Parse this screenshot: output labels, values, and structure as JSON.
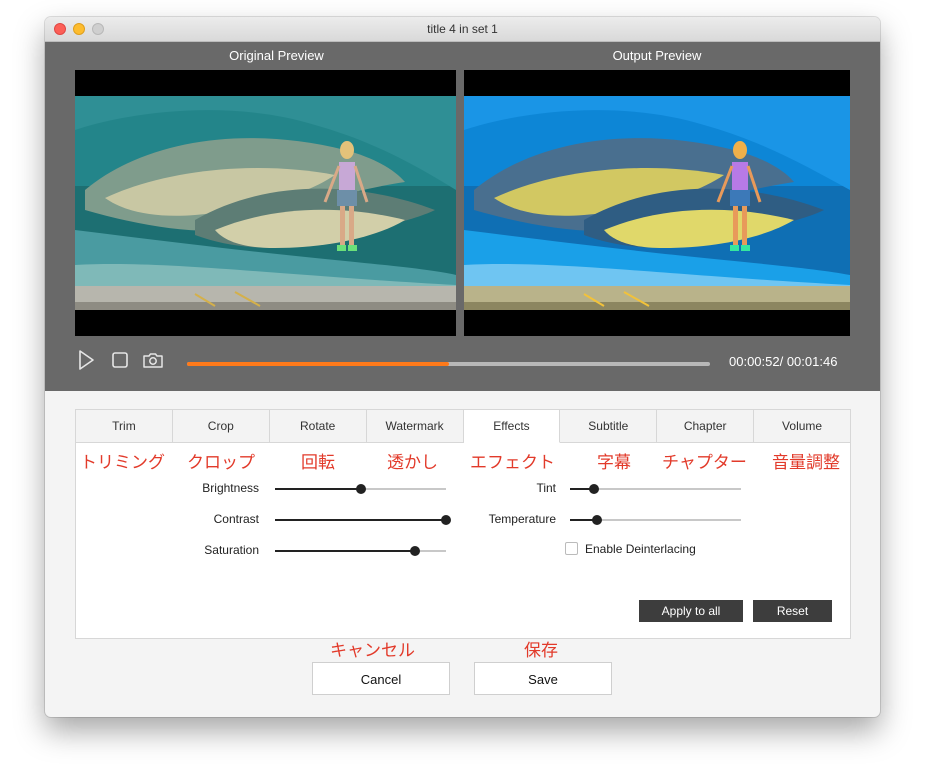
{
  "window": {
    "title": "title 4 in set 1"
  },
  "preview": {
    "original_label": "Original Preview",
    "output_label": "Output  Preview",
    "time": "00:00:52/ 00:01:46",
    "progress": 0.5
  },
  "tabs": [
    {
      "label": "Trim",
      "jp": "トリミング"
    },
    {
      "label": "Crop",
      "jp": "クロップ"
    },
    {
      "label": "Rotate",
      "jp": "回転"
    },
    {
      "label": "Watermark",
      "jp": "透かし"
    },
    {
      "label": "Effects",
      "jp": "エフェクト",
      "active": true
    },
    {
      "label": "Subtitle",
      "jp": "字幕"
    },
    {
      "label": "Chapter",
      "jp": "チャプター"
    },
    {
      "label": "Volume",
      "jp": "音量調整"
    }
  ],
  "effects": {
    "brightness": {
      "label": "Brightness",
      "value": 0.5
    },
    "contrast": {
      "label": "Contrast",
      "value": 1.0
    },
    "saturation": {
      "label": "Saturation",
      "value": 0.82
    },
    "tint": {
      "label": "Tint",
      "value": 0.14
    },
    "temperature": {
      "label": "Temperature",
      "value": 0.16
    },
    "deinterlace": {
      "label": "Enable Deinterlacing",
      "checked": false
    }
  },
  "buttons": {
    "apply_all": "Apply to all",
    "reset": "Reset",
    "cancel": "Cancel",
    "cancel_jp": "キャンセル",
    "save": "Save",
    "save_jp": "保存"
  },
  "colors": {
    "accent": "#ff7a1a",
    "annotation": "#e23a2a"
  }
}
